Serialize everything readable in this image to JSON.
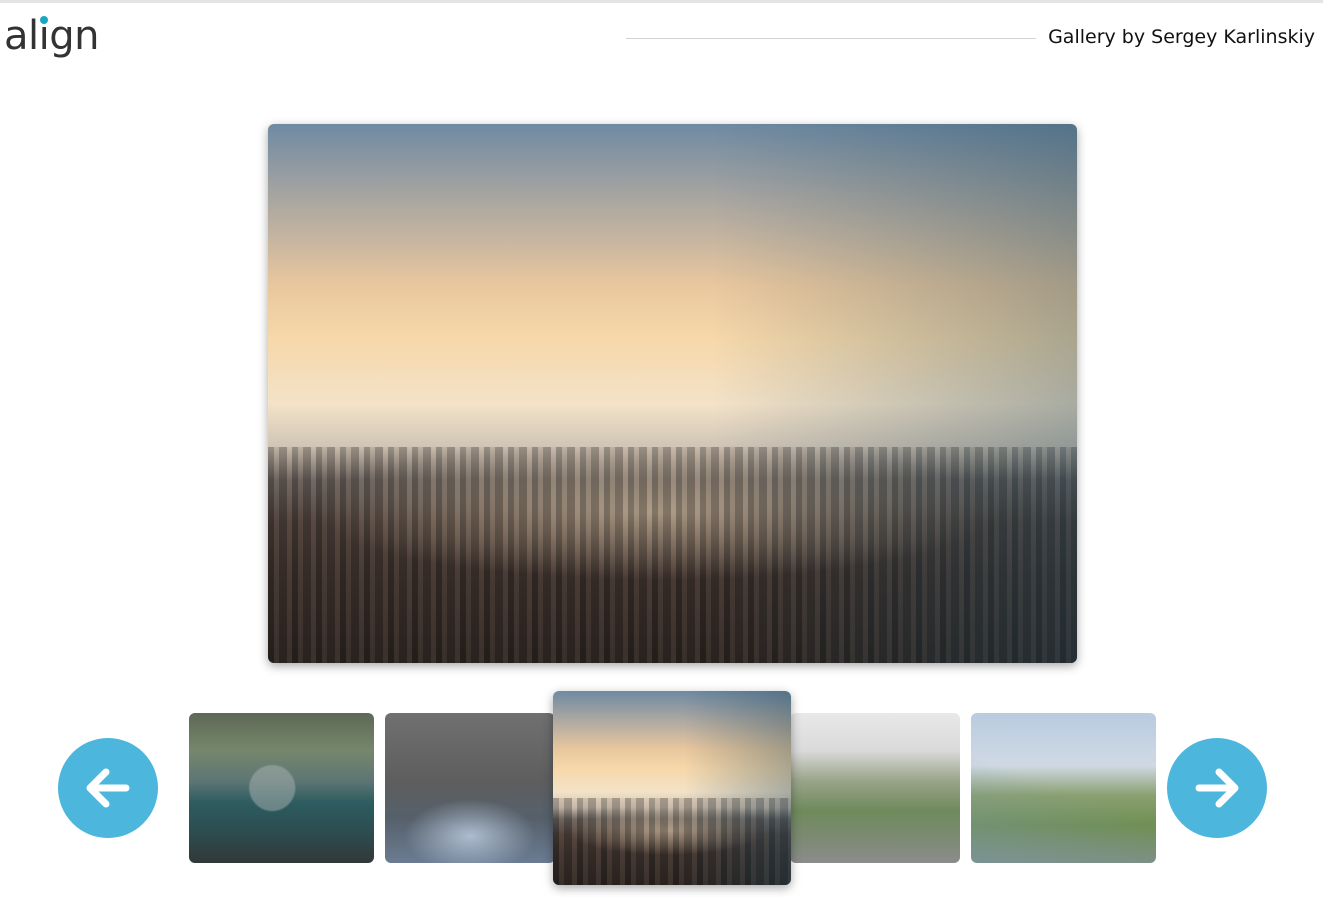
{
  "header": {
    "logo_left": "al",
    "logo_i": "i",
    "logo_right": "gn",
    "credit": "Gallery by Sergey Karlinskiy"
  },
  "colors": {
    "accent": "#4cb6dc",
    "logo_dot": "#1ba6c4",
    "text": "#222222"
  },
  "gallery": {
    "active_index": 3,
    "thumbnail_count": 5,
    "main_photo": "city-skyline-sunset",
    "thumbnails": [
      "vintage-car-interior",
      "couple-in-light",
      "city-skyline-sunset",
      "park-and-skyscraper",
      "coastal-cliffs"
    ],
    "prev_icon": "arrow-left-icon",
    "next_icon": "arrow-right-icon"
  }
}
